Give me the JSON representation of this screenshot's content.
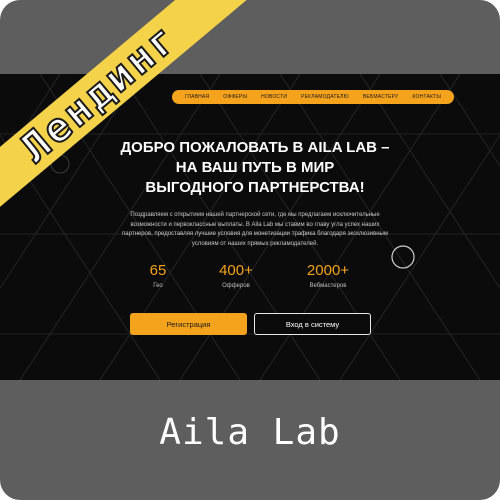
{
  "ribbon": {
    "label": "Лендинг"
  },
  "nav": {
    "items": [
      "Главная",
      "Офферы",
      "Новости",
      "Рекламодателю",
      "Вебмастеру",
      "Контакты"
    ]
  },
  "hero": {
    "title_line1": "ДОБРО ПОЖАЛОВАТЬ В AILA LAB –",
    "title_line2": "НА ВАШ ПУТЬ В МИР",
    "title_line3": "ВЫГОДНОГО ПАРТНЕРСТВА!",
    "text": "Поздравляем с открытием нашей партнерской сети, где мы предлагаем исключительные возможности и первоклассные выплаты. В Aila Lab мы ставим во главу угла успех наших партнеров, предоставляя лучшие условия для монетизации трафика благодаря эксклюзивным условиям от наших прямых рекламодателей."
  },
  "stats": [
    {
      "value": "65",
      "label": "Гео"
    },
    {
      "value": "400+",
      "label": "Офферов"
    },
    {
      "value": "2000+",
      "label": "Вебмастеров"
    }
  ],
  "buttons": {
    "register": "Регистрация",
    "login": "Вход в систему"
  },
  "footer": {
    "title": "Aila Lab"
  },
  "colors": {
    "accent": "#f5a21c",
    "ribbon": "#f4d24a",
    "frame": "#5e5e5e",
    "hero_bg": "#0b0b0b"
  }
}
